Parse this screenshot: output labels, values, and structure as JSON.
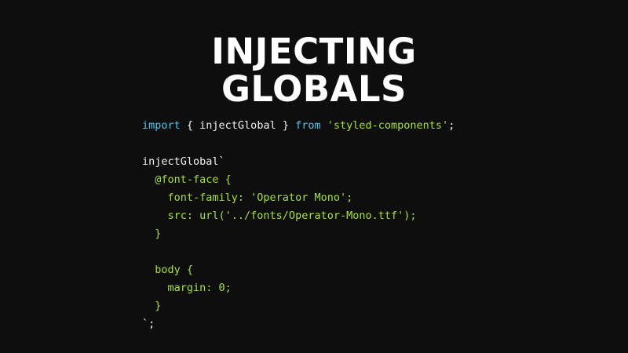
{
  "slide": {
    "title_line1": "INJECTING",
    "title_line2": "GLOBALS"
  },
  "code": {
    "lines": [
      [
        {
          "t": "import",
          "k": "kw"
        },
        {
          "t": " { injectGlobal } ",
          "k": "plain"
        },
        {
          "t": "from",
          "k": "kw"
        },
        {
          "t": " ",
          "k": "plain"
        },
        {
          "t": "'styled-components'",
          "k": "str"
        },
        {
          "t": ";",
          "k": "plain"
        }
      ],
      [],
      [
        {
          "t": "injectGlobal`",
          "k": "plain"
        }
      ],
      [
        {
          "t": "  @font-face {",
          "k": "css"
        }
      ],
      [
        {
          "t": "    font-family: 'Operator Mono';",
          "k": "css"
        }
      ],
      [
        {
          "t": "    src: url('../fonts/Operator-Mono.ttf');",
          "k": "css"
        }
      ],
      [
        {
          "t": "  }",
          "k": "css"
        }
      ],
      [],
      [
        {
          "t": "  body {",
          "k": "css"
        }
      ],
      [
        {
          "t": "    margin: 0;",
          "k": "css"
        }
      ],
      [
        {
          "t": "  }",
          "k": "css"
        }
      ],
      [
        {
          "t": "`;",
          "k": "plain"
        }
      ]
    ]
  },
  "colors": {
    "background": "#0e0e0e",
    "title": "#ffffff",
    "keyword": "#4cc7f0",
    "string": "#a6e22e",
    "plain": "#f2f2f2"
  }
}
